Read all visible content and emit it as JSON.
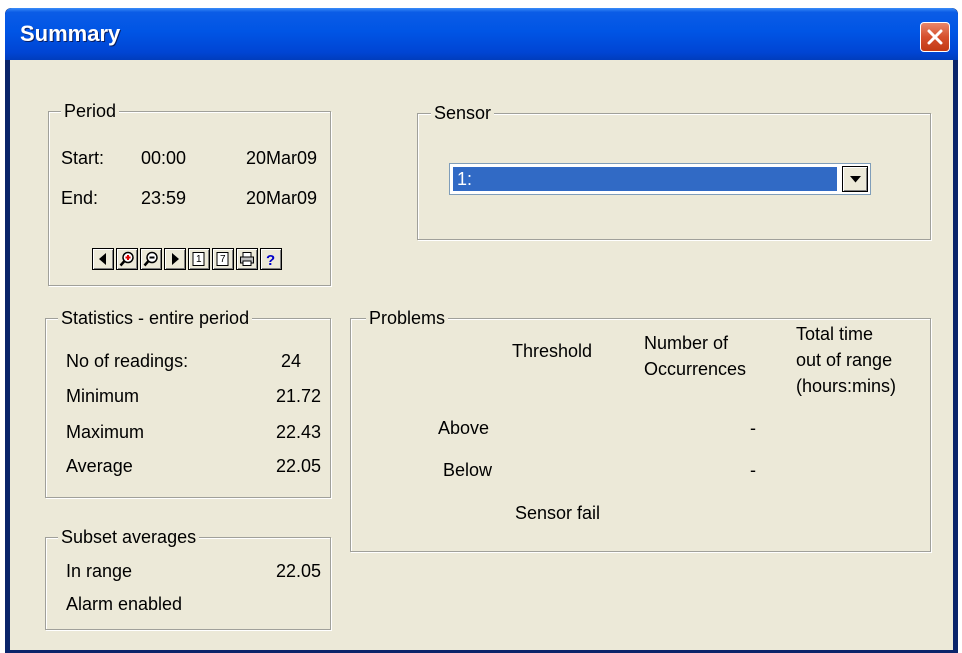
{
  "window": {
    "title": "Summary"
  },
  "period": {
    "legend": "Period",
    "start_label": "Start:",
    "start_time": "00:00",
    "start_date": "20Mar09",
    "end_label": "End:",
    "end_time": "23:59",
    "end_date": "20Mar09",
    "toolbar": [
      "previous-icon",
      "zoom-in-icon",
      "zoom-out-icon",
      "next-icon",
      "day-1-icon",
      "day-7-icon",
      "printer-icon",
      "help-icon"
    ],
    "toolbar_glyphs": {
      "day1": "1",
      "day7": "7",
      "help": "?"
    }
  },
  "sensor": {
    "legend": "Sensor",
    "selected": "1:"
  },
  "statistics": {
    "legend": "Statistics - entire period",
    "rows": [
      {
        "label": "No of readings:",
        "value": "24"
      },
      {
        "label": "Minimum",
        "value": "21.72"
      },
      {
        "label": "Maximum",
        "value": "22.43"
      },
      {
        "label": "Average",
        "value": "22.05"
      }
    ]
  },
  "subset": {
    "legend": "Subset averages",
    "in_range_label": "In range",
    "in_range_value": "22.05",
    "alarm_label": "Alarm enabled"
  },
  "problems": {
    "legend": "Problems",
    "col_threshold": "Threshold",
    "col_occ_1": "Number of",
    "col_occ_2": "Occurrences",
    "col_time_1": "Total time",
    "col_time_2": "out of range",
    "col_time_3": "(hours:mins)",
    "above_label": "Above",
    "above_occ": "-",
    "below_label": "Below",
    "below_occ": "-",
    "sensor_fail_label": "Sensor fail"
  },
  "colors": {
    "title_bar": "#0055e5",
    "client_bg": "#ece9d8",
    "selection": "#316ac5",
    "close_button": "#d6502d"
  }
}
